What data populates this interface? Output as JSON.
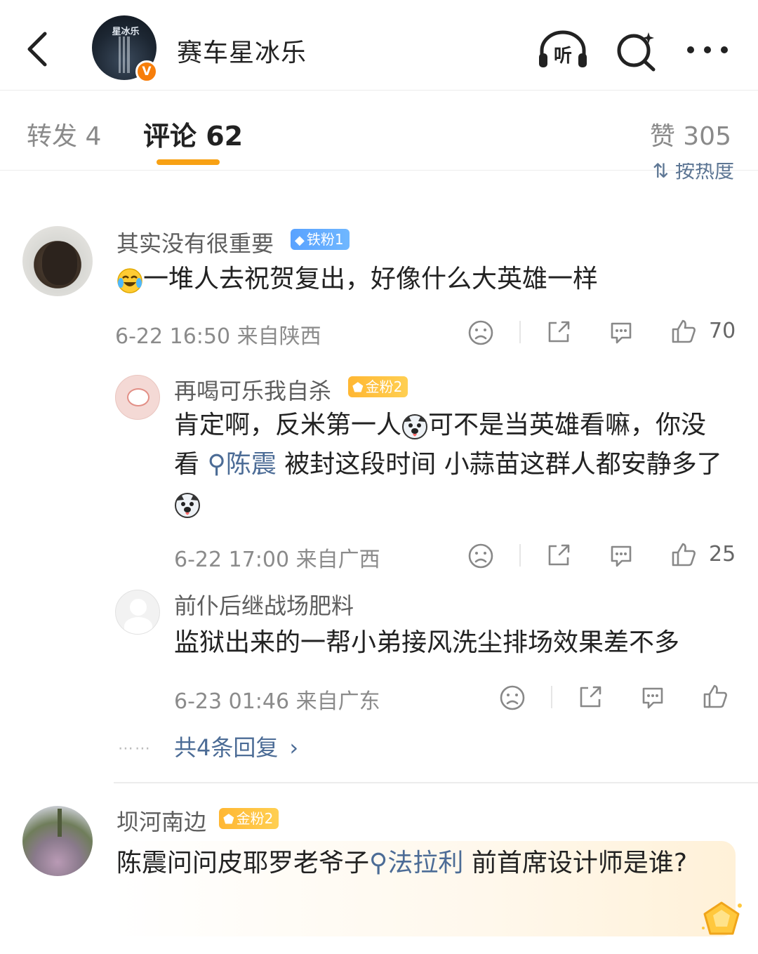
{
  "header": {
    "title": "赛车星冰乐",
    "avatar_label": "星冰乐",
    "verified_mark": "V"
  },
  "tabs": {
    "repost": "转发 4",
    "comments": "评论 62",
    "likes": "赞 305"
  },
  "sort_label": "按热度",
  "comments": [
    {
      "user": "其实没有很重要",
      "badge": "铁粉1",
      "text": "一堆人去祝贺复出，好像什么大英雄一样",
      "time_location": "6-22 16:50 来自陕西",
      "likes": "70",
      "replies": [
        {
          "user": "再喝可乐我自杀",
          "badge": "金粉2",
          "text_parts": [
            "肯定啊，反米第一人",
            "可不是当英雄看嘛，你没看 ",
            "陈震",
            " 被封这段时间 小蒜苗这群人都安静多了"
          ],
          "time_location": "6-22 17:00 来自广西",
          "likes": "25"
        },
        {
          "user": "前仆后继战场肥料",
          "text": "监狱出来的一帮小弟接风洗尘排场效果差不多",
          "time_location": "6-23 01:46 来自广东"
        }
      ],
      "more_replies": "共4条回复"
    },
    {
      "user": "坝河南边",
      "badge": "金粉2",
      "text_parts": [
        "陈震问问皮耶罗老爷子",
        "法拉利",
        " 前首席设计师是谁?"
      ]
    }
  ],
  "colors": {
    "accent": "#f8a114",
    "link": "#4c6c96",
    "badge_blue": "#5aa2ff",
    "badge_gold": "#ffb733"
  },
  "icons": [
    "back-icon",
    "listen-icon",
    "search-ai-icon",
    "more-icon",
    "dislike-icon",
    "share-icon",
    "comment-icon",
    "like-icon"
  ]
}
